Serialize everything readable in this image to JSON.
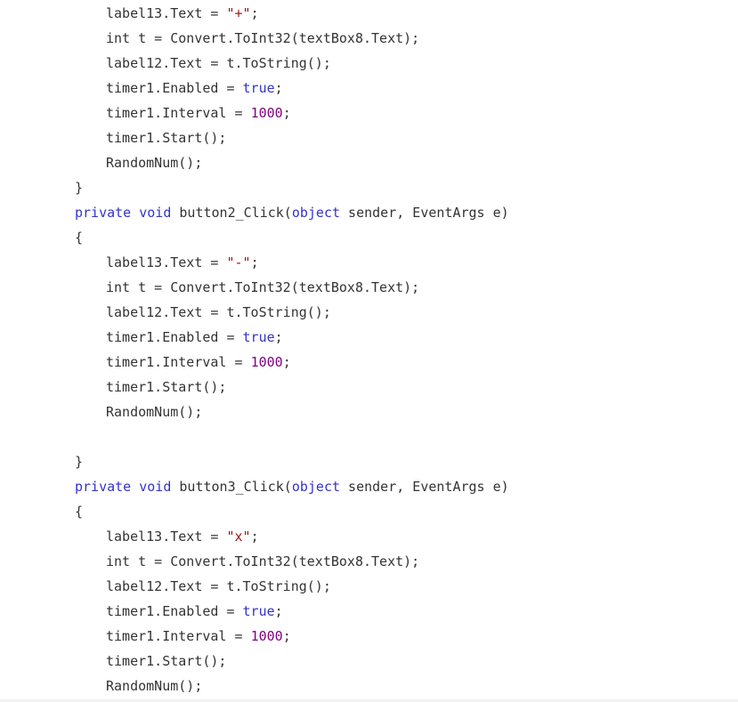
{
  "colors": {
    "background": "#ffffff",
    "text": "#333333",
    "keyword": "#3333cc",
    "string": "#a31515",
    "number": "#800080"
  },
  "code_lines": [
    {
      "indent": 2,
      "tokens": [
        {
          "t": "label13.Text = ",
          "k": "plain"
        },
        {
          "t": "\"+\"",
          "k": "str"
        },
        {
          "t": ";",
          "k": "plain"
        }
      ]
    },
    {
      "indent": 2,
      "tokens": [
        {
          "t": "int t = Convert.ToInt32(textBox8.Text);",
          "k": "plain"
        }
      ]
    },
    {
      "indent": 2,
      "tokens": [
        {
          "t": "label12.Text = t.ToString();",
          "k": "plain"
        }
      ]
    },
    {
      "indent": 2,
      "tokens": [
        {
          "t": "timer1.Enabled = ",
          "k": "plain"
        },
        {
          "t": "true",
          "k": "kw"
        },
        {
          "t": ";",
          "k": "plain"
        }
      ]
    },
    {
      "indent": 2,
      "tokens": [
        {
          "t": "timer1.Interval = ",
          "k": "plain"
        },
        {
          "t": "1000",
          "k": "num"
        },
        {
          "t": ";",
          "k": "plain"
        }
      ]
    },
    {
      "indent": 2,
      "tokens": [
        {
          "t": "timer1.Start();",
          "k": "plain"
        }
      ]
    },
    {
      "indent": 2,
      "tokens": [
        {
          "t": "RandomNum();",
          "k": "plain"
        }
      ]
    },
    {
      "indent": 1,
      "tokens": [
        {
          "t": "}",
          "k": "plain"
        }
      ]
    },
    {
      "indent": 1,
      "tokens": [
        {
          "t": "private",
          "k": "kw"
        },
        {
          "t": " ",
          "k": "plain"
        },
        {
          "t": "void",
          "k": "kw"
        },
        {
          "t": " button2_Click(",
          "k": "plain"
        },
        {
          "t": "object",
          "k": "kw"
        },
        {
          "t": " sender, EventArgs e)",
          "k": "plain"
        }
      ]
    },
    {
      "indent": 1,
      "tokens": [
        {
          "t": "{",
          "k": "plain"
        }
      ]
    },
    {
      "indent": 2,
      "tokens": [
        {
          "t": "label13.Text = ",
          "k": "plain"
        },
        {
          "t": "\"-\"",
          "k": "str"
        },
        {
          "t": ";",
          "k": "plain"
        }
      ]
    },
    {
      "indent": 2,
      "tokens": [
        {
          "t": "int t = Convert.ToInt32(textBox8.Text);",
          "k": "plain"
        }
      ]
    },
    {
      "indent": 2,
      "tokens": [
        {
          "t": "label12.Text = t.ToString();",
          "k": "plain"
        }
      ]
    },
    {
      "indent": 2,
      "tokens": [
        {
          "t": "timer1.Enabled = ",
          "k": "plain"
        },
        {
          "t": "true",
          "k": "kw"
        },
        {
          "t": ";",
          "k": "plain"
        }
      ]
    },
    {
      "indent": 2,
      "tokens": [
        {
          "t": "timer1.Interval = ",
          "k": "plain"
        },
        {
          "t": "1000",
          "k": "num"
        },
        {
          "t": ";",
          "k": "plain"
        }
      ]
    },
    {
      "indent": 2,
      "tokens": [
        {
          "t": "timer1.Start();",
          "k": "plain"
        }
      ]
    },
    {
      "indent": 2,
      "tokens": [
        {
          "t": "RandomNum();",
          "k": "plain"
        }
      ]
    },
    {
      "indent": 0,
      "tokens": []
    },
    {
      "indent": 1,
      "tokens": [
        {
          "t": "}",
          "k": "plain"
        }
      ]
    },
    {
      "indent": 1,
      "tokens": [
        {
          "t": "private",
          "k": "kw"
        },
        {
          "t": " ",
          "k": "plain"
        },
        {
          "t": "void",
          "k": "kw"
        },
        {
          "t": " button3_Click(",
          "k": "plain"
        },
        {
          "t": "object",
          "k": "kw"
        },
        {
          "t": " sender, EventArgs e)",
          "k": "plain"
        }
      ]
    },
    {
      "indent": 1,
      "tokens": [
        {
          "t": "{",
          "k": "plain"
        }
      ]
    },
    {
      "indent": 2,
      "tokens": [
        {
          "t": "label13.Text = ",
          "k": "plain"
        },
        {
          "t": "\"x\"",
          "k": "str"
        },
        {
          "t": ";",
          "k": "plain"
        }
      ]
    },
    {
      "indent": 2,
      "tokens": [
        {
          "t": "int t = Convert.ToInt32(textBox8.Text);",
          "k": "plain"
        }
      ]
    },
    {
      "indent": 2,
      "tokens": [
        {
          "t": "label12.Text = t.ToString();",
          "k": "plain"
        }
      ]
    },
    {
      "indent": 2,
      "tokens": [
        {
          "t": "timer1.Enabled = ",
          "k": "plain"
        },
        {
          "t": "true",
          "k": "kw"
        },
        {
          "t": ";",
          "k": "plain"
        }
      ]
    },
    {
      "indent": 2,
      "tokens": [
        {
          "t": "timer1.Interval = ",
          "k": "plain"
        },
        {
          "t": "1000",
          "k": "num"
        },
        {
          "t": ";",
          "k": "plain"
        }
      ]
    },
    {
      "indent": 2,
      "tokens": [
        {
          "t": "timer1.Start();",
          "k": "plain"
        }
      ]
    },
    {
      "indent": 2,
      "tokens": [
        {
          "t": "RandomNum();",
          "k": "plain"
        }
      ]
    }
  ]
}
